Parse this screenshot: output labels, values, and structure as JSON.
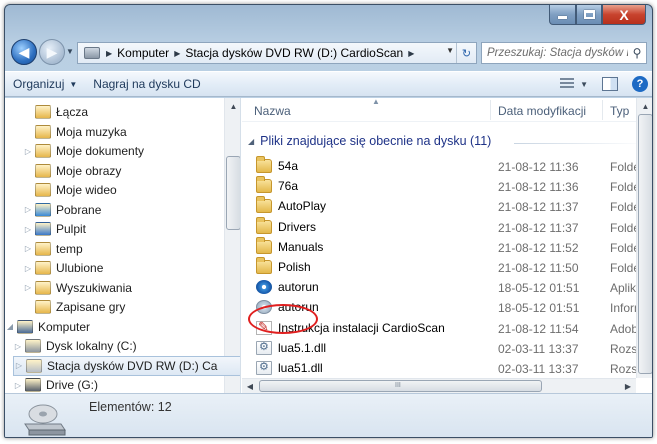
{
  "window": {
    "address_crumbs": [
      "Komputer",
      "Stacja dysków DVD RW (D:) CardioScan"
    ],
    "search_placeholder": "Przeszukaj: Stacja dysków DV...",
    "caption_icons": [
      "minimize-icon",
      "maximize-icon",
      "close-icon"
    ],
    "close_glyph": "X"
  },
  "toolbar": {
    "organize_label": "Organizuj",
    "burn_label": "Nagraj na dysku CD"
  },
  "nav_tree": [
    {
      "label": "Łącza",
      "icon": "links-folder-icon",
      "expander": ""
    },
    {
      "label": "Moja muzyka",
      "icon": "music-folder-icon",
      "expander": ""
    },
    {
      "label": "Moje dokumenty",
      "icon": "documents-folder-icon",
      "expander": "▷"
    },
    {
      "label": "Moje obrazy",
      "icon": "pictures-folder-icon",
      "expander": ""
    },
    {
      "label": "Moje wideo",
      "icon": "videos-folder-icon",
      "expander": ""
    },
    {
      "label": "Pobrane",
      "icon": "downloads-folder-icon",
      "expander": "▷"
    },
    {
      "label": "Pulpit",
      "icon": "desktop-folder-icon",
      "expander": "▷"
    },
    {
      "label": "temp",
      "icon": "folder-icon",
      "expander": "▷"
    },
    {
      "label": "Ulubione",
      "icon": "favorites-folder-icon",
      "expander": "▷"
    },
    {
      "label": "Wyszukiwania",
      "icon": "searches-folder-icon",
      "expander": "▷"
    },
    {
      "label": "Zapisane gry",
      "icon": "saved-games-folder-icon",
      "expander": ""
    },
    {
      "label": "Komputer",
      "icon": "computer-icon",
      "expander": "◢"
    },
    {
      "label": "Dysk lokalny (C:)",
      "icon": "hard-drive-icon",
      "expander": "▷"
    },
    {
      "label": "Stacja dysków DVD RW (D:) Ca",
      "icon": "dvd-drive-icon",
      "expander": "▷",
      "selected": true
    },
    {
      "label": "Drive (G:)",
      "icon": "network-drive-icon",
      "expander": "▷"
    }
  ],
  "columns": {
    "name": "Nazwa",
    "date": "Data modyfikacji",
    "type": "Typ"
  },
  "group_header": "Pliki znajdujące się obecnie na dysku (11)",
  "files": [
    {
      "name": "54a",
      "date": "21-08-12 11:36",
      "type": "Folder p",
      "icon": "folder-icon"
    },
    {
      "name": "76a",
      "date": "21-08-12 11:36",
      "type": "Folder p",
      "icon": "folder-icon"
    },
    {
      "name": "AutoPlay",
      "date": "21-08-12 11:37",
      "type": "Folder p",
      "icon": "folder-icon"
    },
    {
      "name": "Drivers",
      "date": "21-08-12 11:37",
      "type": "Folder p",
      "icon": "folder-icon",
      "highlighted": true
    },
    {
      "name": "Manuals",
      "date": "21-08-12 11:52",
      "type": "Folder p",
      "icon": "folder-icon"
    },
    {
      "name": "Polish",
      "date": "21-08-12 11:50",
      "type": "Folder p",
      "icon": "folder-icon"
    },
    {
      "name": "autorun",
      "date": "18-05-12 01:51",
      "type": "Aplikacj",
      "icon": "autorun-app-icon"
    },
    {
      "name": "autorun",
      "date": "18-05-12 01:51",
      "type": "Informa",
      "icon": "autorun-setup-icon"
    },
    {
      "name": "Instrukcja instalacji CardioScan",
      "date": "21-08-12 11:54",
      "type": "Adobe A",
      "icon": "pdf-icon"
    },
    {
      "name": "lua5.1.dll",
      "date": "02-03-11 13:37",
      "type": "Rozszer",
      "icon": "dll-icon"
    },
    {
      "name": "lua51.dll",
      "date": "02-03-11 13:37",
      "type": "Rozszer",
      "icon": "dll-icon"
    }
  ],
  "details": {
    "item_count": "Elementów: 12"
  },
  "highlight_color": "#e01f1f",
  "group_header_color": "#1e3287"
}
